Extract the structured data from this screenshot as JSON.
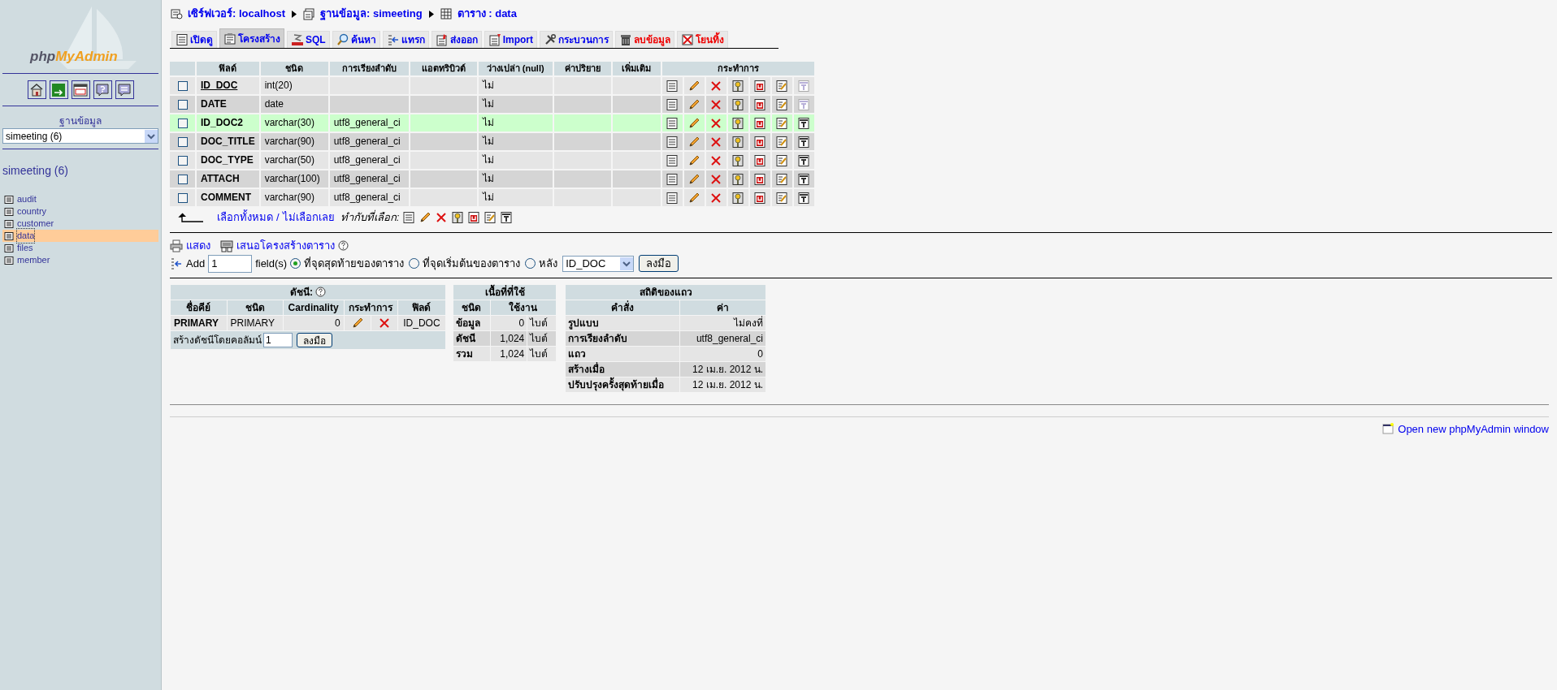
{
  "sidebar": {
    "logo_prefix": "php",
    "logo_suffix": "MyAdmin",
    "database_label": "ฐานข้อมูล",
    "database_select": "simeeting (6)",
    "database_title": "simeeting (6)",
    "tables": [
      {
        "name": "audit",
        "selected": false
      },
      {
        "name": "country",
        "selected": false
      },
      {
        "name": "customer",
        "selected": false
      },
      {
        "name": "data",
        "selected": true
      },
      {
        "name": "files",
        "selected": false
      },
      {
        "name": "member",
        "selected": false
      }
    ]
  },
  "breadcrumb": [
    {
      "kind": "server",
      "label": "เซิร์ฟเวอร์: localhost"
    },
    {
      "kind": "database",
      "label": "ฐานข้อมูล: simeeting"
    },
    {
      "kind": "table",
      "label": "ตาราง : data"
    }
  ],
  "tabs": [
    {
      "kind": "browse",
      "label": "เปิดดู",
      "selected": false,
      "danger": false
    },
    {
      "kind": "structure",
      "label": "โครงสร้าง",
      "selected": true,
      "danger": false
    },
    {
      "kind": "sql",
      "label": "SQL",
      "selected": false,
      "danger": false
    },
    {
      "kind": "search",
      "label": "ค้นหา",
      "selected": false,
      "danger": false
    },
    {
      "kind": "insert",
      "label": "แทรก",
      "selected": false,
      "danger": false
    },
    {
      "kind": "export",
      "label": "ส่งออก",
      "selected": false,
      "danger": false
    },
    {
      "kind": "import",
      "label": "Import",
      "selected": false,
      "danger": false
    },
    {
      "kind": "operations",
      "label": "กระบวนการ",
      "selected": false,
      "danger": false
    },
    {
      "kind": "empty",
      "label": "ลบข้อมูล",
      "selected": false,
      "danger": true
    },
    {
      "kind": "drop",
      "label": "โยนทิ้ง",
      "selected": false,
      "danger": true
    }
  ],
  "structure": {
    "columns": [
      "ฟิลด์",
      "ชนิด",
      "การเรียงลำดับ",
      "แอตทริบิวต์",
      "ว่างเปล่า (null)",
      "ค่าปริยาย",
      "เพิ่มเติม",
      "กระทำการ"
    ],
    "rows": [
      {
        "field": "ID_DOC",
        "type": "int(20)",
        "null": "ไม่",
        "primary": true,
        "checked": false,
        "highlighted": false,
        "fulltext_available": false
      },
      {
        "field": "DATE",
        "type": "date",
        "null": "ไม่",
        "primary": false,
        "checked": false,
        "highlighted": false,
        "fulltext_available": false
      },
      {
        "field": "ID_DOC2",
        "type": "varchar(30)",
        "collation": "utf8_general_ci",
        "null": "ไม่",
        "primary": false,
        "checked": false,
        "highlighted": true,
        "fulltext_available": true
      },
      {
        "field": "DOC_TITLE",
        "type": "varchar(90)",
        "collation": "utf8_general_ci",
        "null": "ไม่",
        "primary": false,
        "checked": false,
        "highlighted": false,
        "fulltext_available": true
      },
      {
        "field": "DOC_TYPE",
        "type": "varchar(50)",
        "collation": "utf8_general_ci",
        "null": "ไม่",
        "primary": false,
        "checked": false,
        "highlighted": false,
        "fulltext_available": true
      },
      {
        "field": "ATTACH",
        "type": "varchar(100)",
        "collation": "utf8_general_ci",
        "null": "ไม่",
        "primary": false,
        "checked": false,
        "highlighted": false,
        "fulltext_available": true
      },
      {
        "field": "COMMENT",
        "type": "varchar(90)",
        "collation": "utf8_general_ci",
        "null": "ไม่",
        "primary": false,
        "checked": false,
        "highlighted": false,
        "fulltext_available": true
      }
    ],
    "check_all": "เลือกทั้งหมด",
    "separator": "/",
    "uncheck_all": "ไม่เลือกเลย",
    "with_selected": "ทำกับที่เลือก:"
  },
  "links": {
    "print": "แสดง",
    "propose": "เสนอโครงสร้างตาราง"
  },
  "add_fields": {
    "label": "Add",
    "value": "1",
    "unit": "field(s)",
    "options": [
      {
        "label": "ที่จุดสุดท้ายของตาราง",
        "selected": true
      },
      {
        "label": "ที่จุดเริ่มต้นของตาราง",
        "selected": false
      },
      {
        "label": "หลัง",
        "selected": false
      }
    ],
    "after_field": "ID_DOC",
    "button": "ลงมือ"
  },
  "indexes": {
    "title": "ดัชนี:",
    "columns": [
      "ชื่อคีย์",
      "ชนิด",
      "Cardinality",
      "กระทำการ",
      "ฟิลด์"
    ],
    "rows": [
      {
        "key_name": "PRIMARY",
        "type": "PRIMARY",
        "cardinality": "0",
        "field": "ID_DOC"
      }
    ],
    "create_label": "สร้างดัชนีโดยคอลัมน์",
    "create_value": "1",
    "button": "ลงมือ"
  },
  "space_usage": {
    "title": "เนื้อที่ที่ใช้",
    "columns": [
      "ชนิด",
      "ใช้งาน"
    ],
    "rows": [
      {
        "label": "ข้อมูล",
        "value": "0",
        "unit": "ไบต์"
      },
      {
        "label": "ดัชนี",
        "value": "1,024",
        "unit": "ไบต์"
      },
      {
        "label": "รวม",
        "value": "1,024",
        "unit": "ไบต์"
      }
    ]
  },
  "row_stats": {
    "title": "สถิติของแถว",
    "columns": [
      "คำสั่ง",
      "ค่า"
    ],
    "rows": [
      {
        "label": "รูปแบบ",
        "value": "ไม่คงที่"
      },
      {
        "label": "การเรียงลำดับ",
        "value": "utf8_general_ci"
      },
      {
        "label": "แถว",
        "value": "0"
      },
      {
        "label": "สร้างเมื่อ",
        "value": "12 เม.ย. 2012 น."
      },
      {
        "label": "ปรับปรุงครั้งสุดท้ายเมื่อ",
        "value": "12 เม.ย. 2012 น."
      }
    ]
  },
  "footer_link": "Open new phpMyAdmin window"
}
